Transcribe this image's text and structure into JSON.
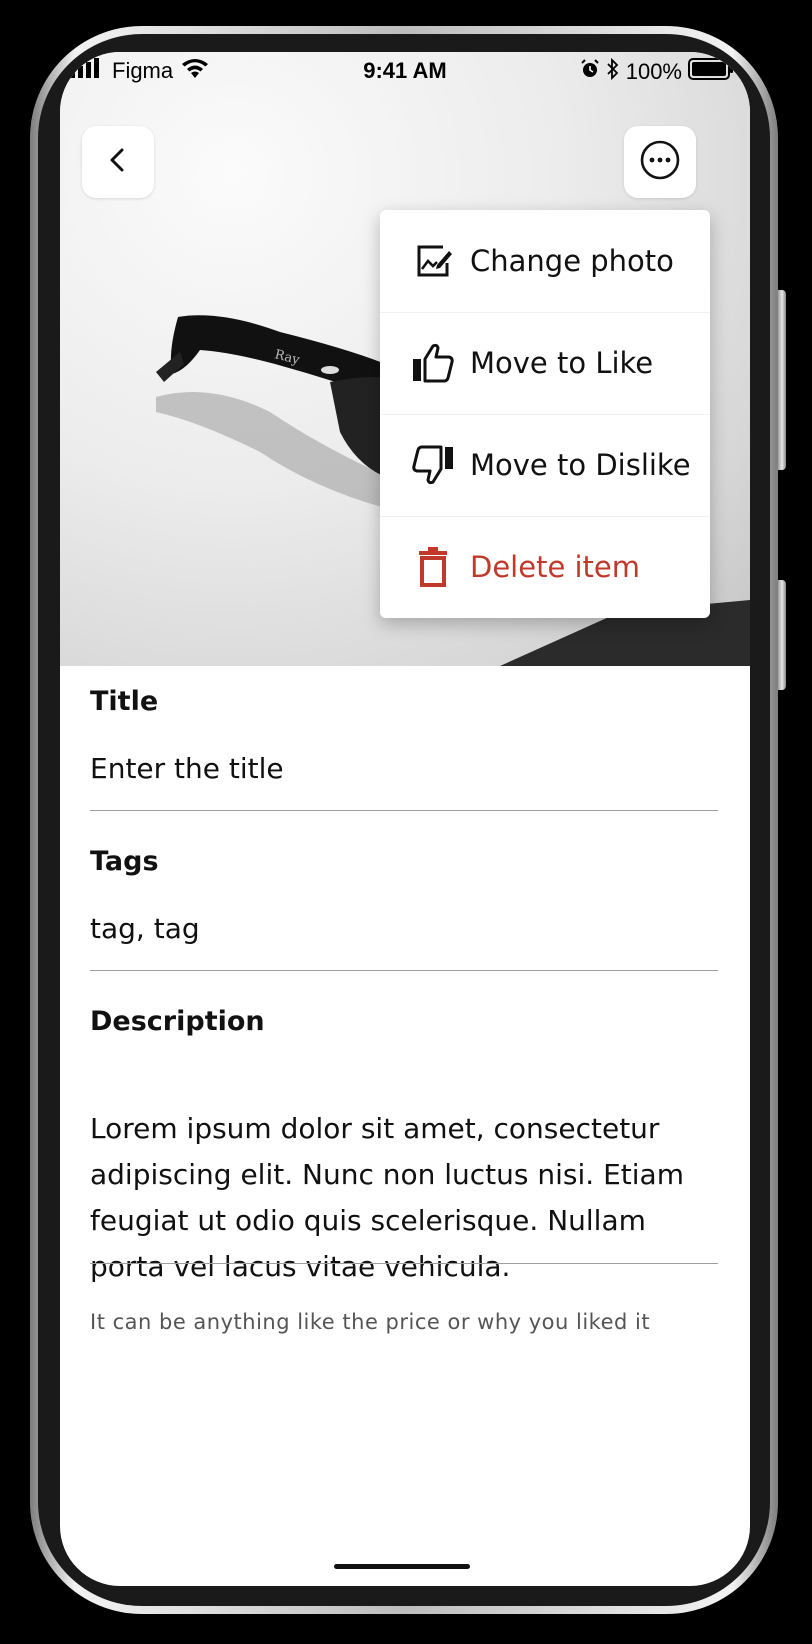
{
  "status_bar": {
    "carrier": "Figma",
    "time": "9:41 AM",
    "battery": "100%"
  },
  "header": {
    "back_icon": "chevron-left-icon",
    "more_icon": "more-horizontal-icon"
  },
  "menu": {
    "items": [
      {
        "label": "Change photo",
        "icon": "edit-image-icon",
        "color": "#111111"
      },
      {
        "label": "Move to Like",
        "icon": "thumbs-up-icon",
        "color": "#111111"
      },
      {
        "label": "Move to Dislike",
        "icon": "thumbs-down-icon",
        "color": "#111111"
      },
      {
        "label": "Delete item",
        "icon": "trash-icon",
        "color": "#c0392b"
      }
    ]
  },
  "form": {
    "title_label": "Title",
    "title_value": "Enter the title",
    "tags_label": "Tags",
    "tags_value": "tag, tag",
    "description_label": "Description",
    "description_value": "Lorem ipsum dolor sit amet, consectetur adipiscing elit. Nunc non luctus nisi. Etiam feugiat ut odio quis scelerisque. Nullam porta vel lacus vitae vehicula.",
    "description_hint": "It can be anything like the price or why you liked it"
  },
  "colors": {
    "danger": "#c0392b",
    "text": "#111111",
    "divider": "#9e9e9e"
  }
}
